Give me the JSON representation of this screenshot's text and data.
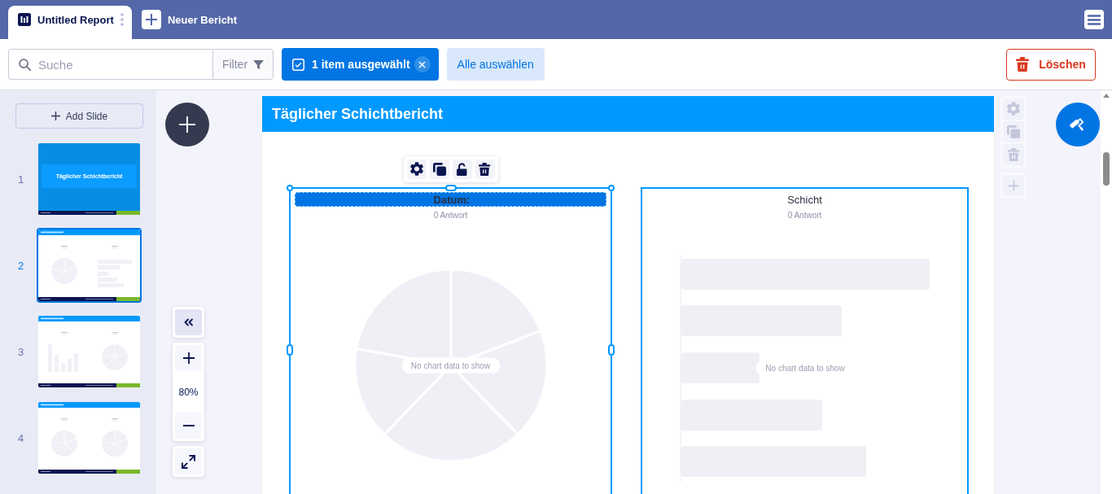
{
  "header": {
    "tabs": [
      {
        "label": "Untitled Report",
        "selected": true
      }
    ],
    "new_report": {
      "label": "Neuer Bericht"
    }
  },
  "toolbar": {
    "search": {
      "placeholder": "Suche"
    },
    "filter": {
      "label": "Filter"
    },
    "selection": {
      "label": "1 item ausgewählt"
    },
    "select_all": {
      "label": "Alle auswählen"
    },
    "delete": {
      "label": "Löschen"
    }
  },
  "sidebar": {
    "add_slide": {
      "label": "Add Slide"
    },
    "slides": [
      {
        "number": "1",
        "kind": "title",
        "title": "Täglicher Schichtbericht",
        "selected": false
      },
      {
        "number": "2",
        "kind": "pie_hbar",
        "selected": true
      },
      {
        "number": "3",
        "kind": "vbar_pie",
        "selected": false
      },
      {
        "number": "4",
        "kind": "pie_pie",
        "selected": false
      }
    ]
  },
  "zoom": {
    "reading": "80%"
  },
  "slide": {
    "title": "Täglicher Schichtbericht",
    "widgets": [
      {
        "kind": "pie",
        "title": "Datum:",
        "responses": "0 Antwort",
        "empty_message": "No chart data to show",
        "selected": true
      },
      {
        "kind": "bar",
        "title": "Schicht",
        "responses": "0 Antwort",
        "empty_message": "No chart data to show",
        "selected": false
      }
    ]
  },
  "widget_toolbar": [
    {
      "kind": "settings"
    },
    {
      "kind": "duplicate"
    },
    {
      "kind": "unlock"
    },
    {
      "kind": "delete"
    }
  ],
  "element_tools": [
    {
      "kind": "settings",
      "disabled": true
    },
    {
      "kind": "duplicate",
      "disabled": true
    },
    {
      "kind": "delete",
      "disabled": true
    },
    {
      "kind": "add",
      "disabled": true
    }
  ]
}
